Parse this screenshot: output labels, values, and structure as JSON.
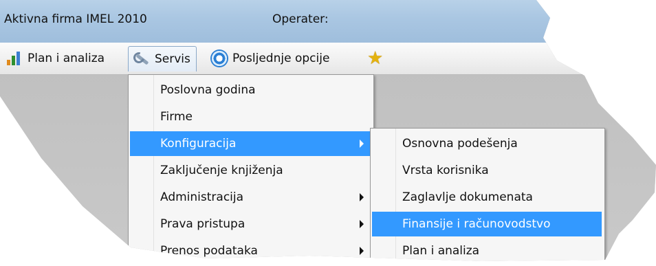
{
  "titlebar": {
    "app_title": "Aktivna firma IMEL 2010",
    "operator_label": "Operater:"
  },
  "menubar": {
    "items": [
      {
        "label": "Plan i analiza",
        "icon": "bar-chart-icon"
      },
      {
        "label": "Servis",
        "icon": "wrench-icon"
      },
      {
        "label": "Posljednje opcije",
        "icon": "recent-options-icon"
      },
      {
        "label": "",
        "icon": "star-icon"
      }
    ]
  },
  "servis_menu": {
    "items": [
      {
        "label": "Poslovna godina",
        "has_submenu": false
      },
      {
        "label": "Firme",
        "has_submenu": false
      },
      {
        "label": "Konfiguracija",
        "has_submenu": true,
        "selected": true
      },
      {
        "label": "Zaključenje knjiženja",
        "has_submenu": false
      },
      {
        "label": "Administracija",
        "has_submenu": true
      },
      {
        "label": "Prava pristupa",
        "has_submenu": true
      },
      {
        "label": "Prenos podataka",
        "has_submenu": true
      }
    ]
  },
  "konfiguracija_submenu": {
    "items": [
      {
        "label": "Osnovna podešenja"
      },
      {
        "label": "Vrsta korisnika"
      },
      {
        "label": "Zaglavlje dokumenata"
      },
      {
        "label": "Finansije i računovodstvo",
        "selected": true
      },
      {
        "label": "Plan i analiza"
      }
    ]
  },
  "colors": {
    "selection": "#3399ff",
    "titlebar": "#a9c6e2",
    "menu_bg": "#f6f6f6"
  }
}
